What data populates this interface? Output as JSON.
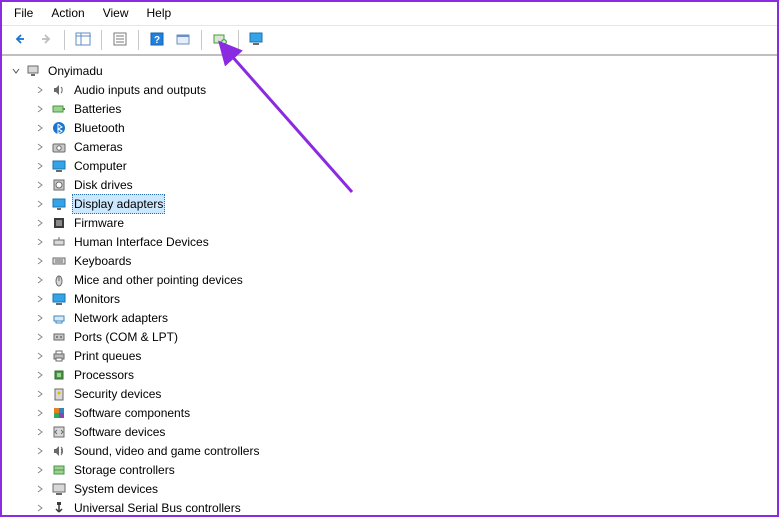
{
  "menubar": {
    "file": "File",
    "action": "Action",
    "view": "View",
    "help": "Help"
  },
  "toolbar": {
    "back_icon": "back-arrow-icon",
    "forward_icon": "forward-arrow-icon",
    "show_hide_icon": "console-tree-icon",
    "properties_icon": "properties-icon",
    "help_icon": "help-icon",
    "show_hidden_icon": "show-hidden-icon",
    "update_driver_icon": "update-driver-icon",
    "monitor_icon": "scan-hardware-icon"
  },
  "tree": {
    "root_name": "Onyimadu",
    "root_expanded": true,
    "items": [
      {
        "label": "Audio inputs and outputs",
        "icon": "speaker-icon"
      },
      {
        "label": "Batteries",
        "icon": "battery-icon"
      },
      {
        "label": "Bluetooth",
        "icon": "bluetooth-icon"
      },
      {
        "label": "Cameras",
        "icon": "camera-icon"
      },
      {
        "label": "Computer",
        "icon": "computer-icon"
      },
      {
        "label": "Disk drives",
        "icon": "disk-icon"
      },
      {
        "label": "Display adapters",
        "icon": "display-icon",
        "selected": true
      },
      {
        "label": "Firmware",
        "icon": "firmware-icon"
      },
      {
        "label": "Human Interface Devices",
        "icon": "hid-icon"
      },
      {
        "label": "Keyboards",
        "icon": "keyboard-icon"
      },
      {
        "label": "Mice and other pointing devices",
        "icon": "mouse-icon"
      },
      {
        "label": "Monitors",
        "icon": "monitor-icon"
      },
      {
        "label": "Network adapters",
        "icon": "network-icon"
      },
      {
        "label": "Ports (COM & LPT)",
        "icon": "port-icon"
      },
      {
        "label": "Print queues",
        "icon": "printer-icon"
      },
      {
        "label": "Processors",
        "icon": "cpu-icon"
      },
      {
        "label": "Security devices",
        "icon": "security-icon"
      },
      {
        "label": "Software components",
        "icon": "software-comp-icon"
      },
      {
        "label": "Software devices",
        "icon": "software-dev-icon"
      },
      {
        "label": "Sound, video and game controllers",
        "icon": "sound-icon"
      },
      {
        "label": "Storage controllers",
        "icon": "storage-icon"
      },
      {
        "label": "System devices",
        "icon": "system-icon"
      },
      {
        "label": "Universal Serial Bus controllers",
        "icon": "usb-icon"
      }
    ]
  },
  "annotation": {
    "arrow_color": "#8a2be2"
  }
}
